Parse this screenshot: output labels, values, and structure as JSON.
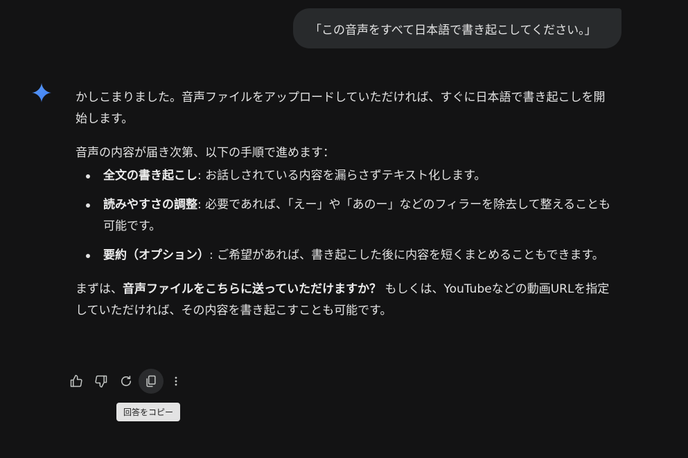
{
  "user_prompt": "「この音声をすべて日本語で書き起こしてください。」",
  "response": {
    "intro": "かしこまりました。音声ファイルをアップロードしていただければ、すぐに日本語で書き起こしを開始します。",
    "steps_heading": "音声の内容が届き次第、以下の手順で進めます：",
    "steps": [
      {
        "title": "全文の書き起こし",
        "text": ": お話しされている内容を漏らさずテキスト化します。"
      },
      {
        "title": "読みやすさの調整",
        "text": ": 必要であれば、「えー」や「あのー」などのフィラーを除去して整えることも可能です。"
      },
      {
        "title": "要約（オプション）",
        "text": ": ご希望があれば、書き起こした後に内容を短くまとめることもできます。"
      }
    ],
    "closing_prefix": "まずは、",
    "closing_bold": "音声ファイルをこちらに送っていただけますか？",
    "closing_suffix": " もしくは、YouTubeなどの動画URLを指定していただければ、その内容を書き起こすことも可能です。"
  },
  "actions": {
    "icons": [
      "thumbs-up-icon",
      "thumbs-down-icon",
      "regenerate-icon",
      "copy-icon",
      "more-vert-icon"
    ],
    "tooltip": "回答をコピー"
  },
  "colors": {
    "background": "#131314",
    "bubble": "#282a2c",
    "text": "#e3e3e3",
    "sparkle": "#4a8cf7"
  }
}
